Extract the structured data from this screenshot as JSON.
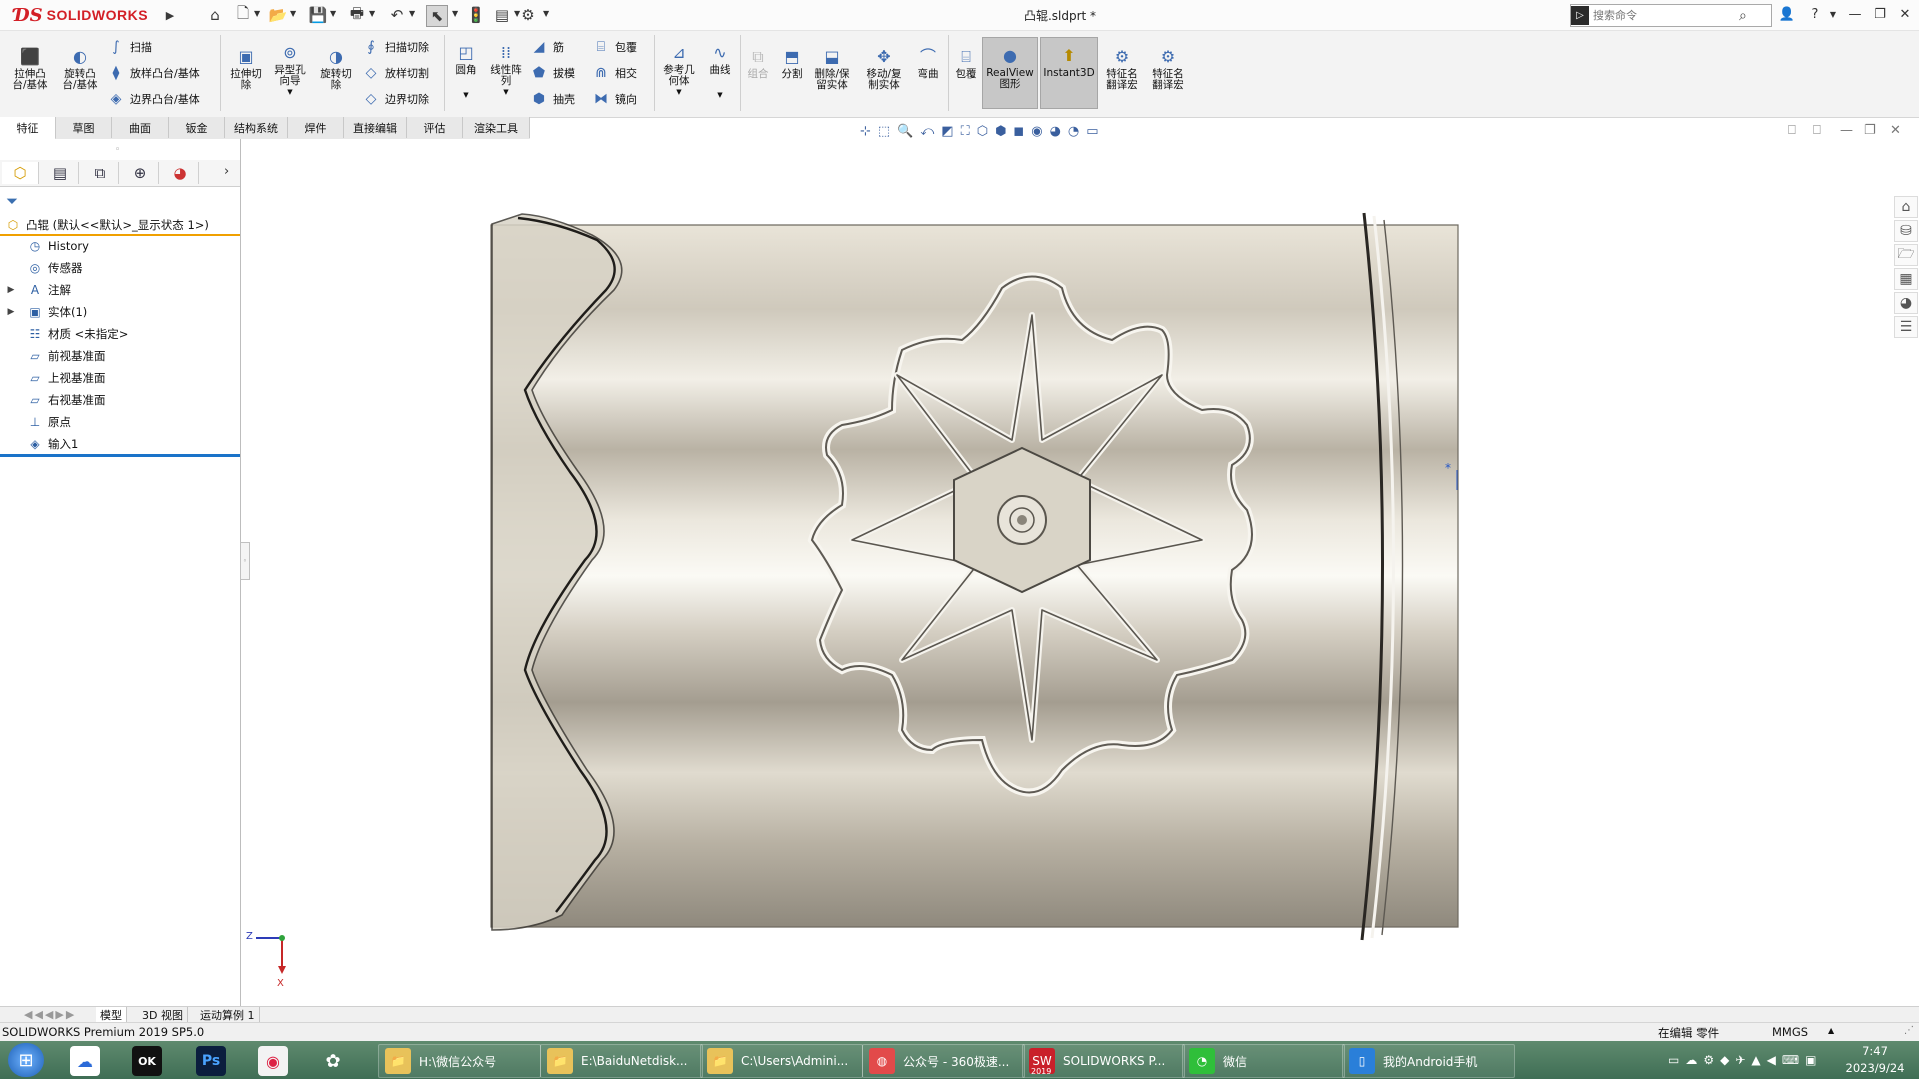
{
  "app": {
    "logo_text": "SOLIDWORKS",
    "document_title": "凸辊.sldprt *",
    "search_placeholder": "搜索命令"
  },
  "command_manager": {
    "group1": [
      {
        "label": "拉伸凸\n台/基体",
        "icon": "extrude-boss-icon"
      },
      {
        "label": "旋转凸\n台/基体",
        "icon": "revolve-boss-icon"
      }
    ],
    "group1_small": [
      "扫描",
      "放样凸台/基体",
      "边界凸台/基体"
    ],
    "group2": [
      {
        "label": "拉伸切\n除",
        "icon": "extrude-cut-icon"
      },
      {
        "label": "异型孔\n向导",
        "icon": "hole-wizard-icon"
      },
      {
        "label": "旋转切\n除",
        "icon": "revolve-cut-icon"
      }
    ],
    "group2_small": [
      "扫描切除",
      "放样切割",
      "边界切除"
    ],
    "group3": [
      {
        "label": "圆角",
        "icon": "fillet-icon"
      },
      {
        "label": "线性阵\n列",
        "icon": "linear-pattern-icon"
      }
    ],
    "group3_small_a": [
      "筋",
      "拔模",
      "抽壳"
    ],
    "group3_small_b": [
      "包覆",
      "相交",
      "镜向"
    ],
    "group4": [
      {
        "label": "参考几\n何体",
        "icon": "reference-geometry-icon"
      },
      {
        "label": "曲线",
        "icon": "curves-icon"
      }
    ],
    "group5": [
      {
        "label": "组合",
        "icon": "combine-icon"
      },
      {
        "label": "分割",
        "icon": "split-icon"
      },
      {
        "label": "删除/保\n留实体",
        "icon": "delete-body-icon"
      },
      {
        "label": "移动/复\n制实体",
        "icon": "move-copy-body-icon"
      },
      {
        "label": "弯曲",
        "icon": "flex-icon"
      }
    ],
    "group6": [
      {
        "label": "包覆",
        "icon": "wrap-icon"
      },
      {
        "label": "RealView\n图形",
        "icon": "realview-icon"
      },
      {
        "label": "Instant3D",
        "icon": "instant3d-icon"
      },
      {
        "label": "特征名\n翻译宏",
        "icon": "macro-icon"
      },
      {
        "label": "特征名\n翻译宏",
        "icon": "macro-icon"
      }
    ]
  },
  "tabs": [
    "特征",
    "草图",
    "曲面",
    "钣金",
    "结构系统",
    "焊件",
    "直接编辑",
    "评估",
    "渲染工具"
  ],
  "feature_tree": {
    "root": "凸辊  (默认<<默认>_显示状态 1>)",
    "items": [
      {
        "label": "History",
        "icon": "history-icon",
        "expand": false
      },
      {
        "label": "传感器",
        "icon": "sensor-icon",
        "expand": false
      },
      {
        "label": "注解",
        "icon": "annotation-icon",
        "expand": true
      },
      {
        "label": "实体(1)",
        "icon": "solid-bodies-icon",
        "expand": true
      },
      {
        "label": "材质 <未指定>",
        "icon": "material-icon",
        "expand": false
      },
      {
        "label": "前视基准面",
        "icon": "plane-icon",
        "expand": false
      },
      {
        "label": "上视基准面",
        "icon": "plane-icon",
        "expand": false
      },
      {
        "label": "右视基准面",
        "icon": "plane-icon",
        "expand": false
      },
      {
        "label": "原点",
        "icon": "origin-icon",
        "expand": false
      },
      {
        "label": "输入1",
        "icon": "imported-body-icon",
        "expand": false
      }
    ]
  },
  "triad": {
    "z": "Z",
    "x": "X"
  },
  "bottom_tabs": [
    "模型",
    "3D 视图",
    "运动算例 1"
  ],
  "status": {
    "product": "SOLIDWORKS Premium 2019 SP5.0",
    "editing": "在编辑 零件",
    "units": "MMGS"
  },
  "taskbar": {
    "apps": [
      {
        "label": "H:\\微信公众号",
        "icon": "folder-icon"
      },
      {
        "label": "E:\\BaiduNetdisk...",
        "icon": "folder-icon"
      },
      {
        "label": "C:\\Users\\Admini...",
        "icon": "folder-icon"
      },
      {
        "label": "公众号 - 360极速...",
        "icon": "browser-icon"
      },
      {
        "label": "SOLIDWORKS P...",
        "icon": "solidworks-icon"
      },
      {
        "label": "微信",
        "icon": "wechat-icon"
      },
      {
        "label": "我的Android手机",
        "icon": "phone-icon"
      }
    ],
    "sw_year": "2019",
    "time": "7:47",
    "date": "2023/9/24"
  },
  "colors": {
    "accent_orange": "#f0a000",
    "accent_blue": "#1a73c9",
    "brand_red": "#d31f26",
    "taskbar": "#4a7a5e"
  }
}
